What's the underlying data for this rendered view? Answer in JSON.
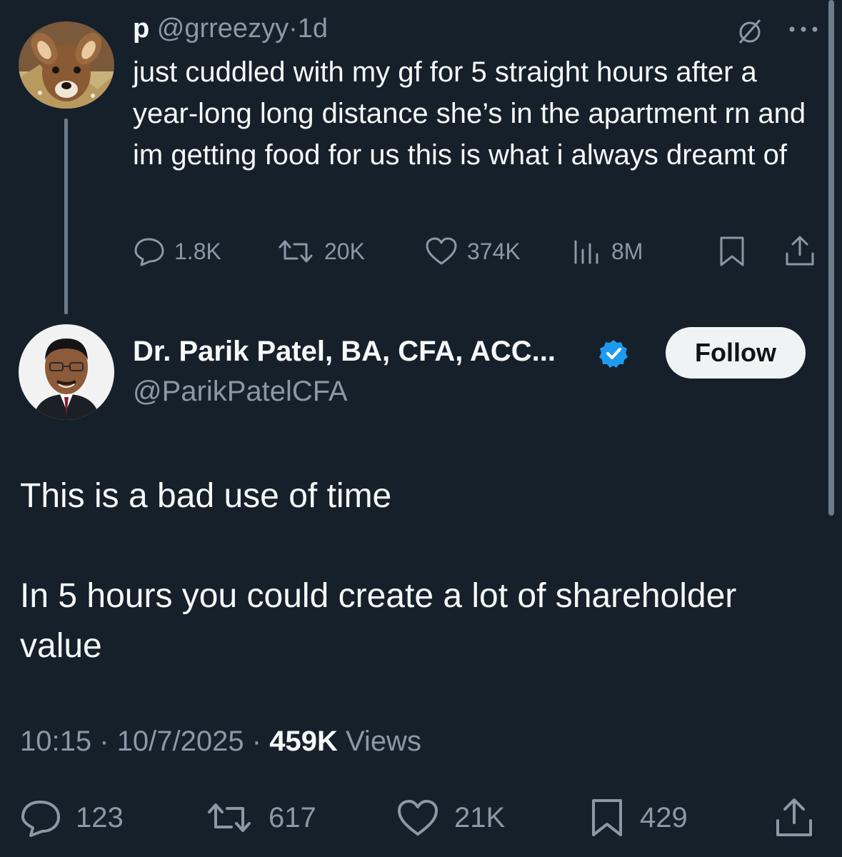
{
  "parent_tweet": {
    "author_name": "p",
    "handle": "@grreezyy",
    "separator": "·",
    "time": "1d",
    "text": "just cuddled with my gf for 5 straight hours after a year-long long distance she’s in the apartment rn and im getting food for us this is what i always dreamt of",
    "avatar_icon": "fawn-avatar",
    "replies": "1.8K",
    "reposts": "20K",
    "likes": "374K",
    "views": "8M"
  },
  "reply_tweet": {
    "author_name": "Dr. Parik Patel, BA, CFA, ACC...",
    "handle": "@ParikPatelCFA",
    "follow_label": "Follow",
    "paragraph_1": "This is a bad use of time",
    "paragraph_2": "In 5 hours you could create a lot of shareholder value",
    "time": "10:15",
    "date": "10/7/2025",
    "separator": "·",
    "views_count": "459K",
    "views_label": "Views",
    "replies": "123",
    "reposts": "617",
    "likes": "21K",
    "bookmarks": "429"
  },
  "colors": {
    "background": "#15202b",
    "text": "#f7f9f9",
    "muted": "#8b98a5",
    "verified": "#1d9bf0",
    "button_bg": "#eff3f4"
  }
}
